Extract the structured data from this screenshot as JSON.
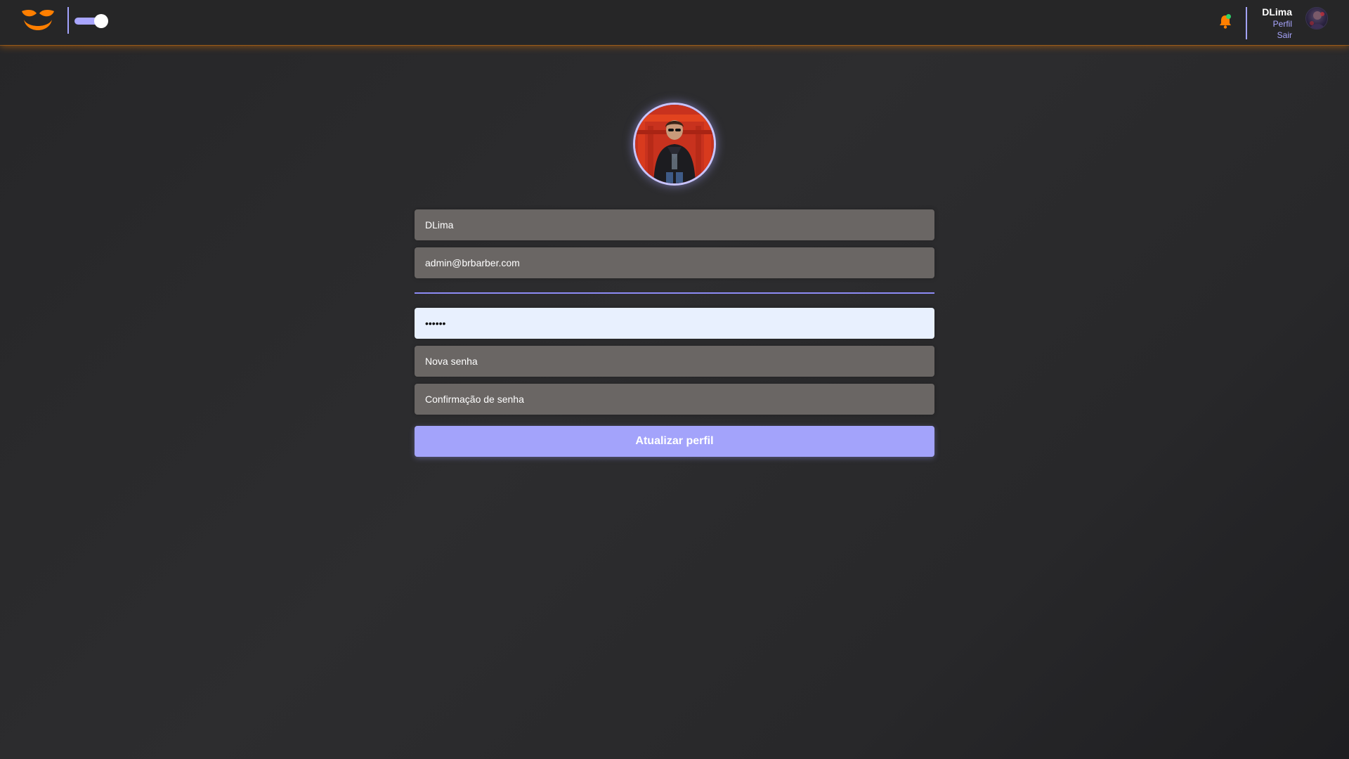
{
  "header": {
    "theme_toggle_on": true,
    "notification_dot": true,
    "user": {
      "name": "DLima",
      "profile_link": "Perfil",
      "logout_link": "Sair"
    }
  },
  "form": {
    "name_value": "DLima",
    "email_value": "admin@brbarber.com",
    "current_password_value": "123456",
    "new_password_placeholder": "Nova senha",
    "confirm_password_placeholder": "Confirmação de senha",
    "submit_label": "Atualizar perfil"
  },
  "colors": {
    "accent": "#a9a6ff",
    "brand_orange": "#ff7f00",
    "field_bg": "#6a6664",
    "autofill_bg": "#e8f0fe",
    "notification_dot": "#2fd36a"
  },
  "icons": [
    "barber-logo-icon",
    "bell-icon"
  ]
}
